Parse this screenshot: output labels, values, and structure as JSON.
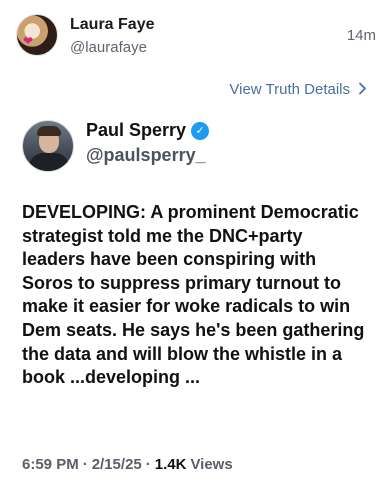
{
  "outer_post": {
    "display_name": "Laura Faye",
    "handle": "@laurafaye",
    "time_ago": "14m",
    "view_link_label": "View Truth Details",
    "view_link_icon": "chevron-right-icon"
  },
  "quoted_post": {
    "display_name": "Paul Sperry",
    "handle": "@paulsperry_",
    "verified": true,
    "verified_color": "#1d9bf0",
    "text": "DEVELOPING: A prominent Democratic strategist told me the DNC+party leaders have been conspiring with Soros to suppress primary turnout to make it easier for woke radicals to win Dem seats. He says he's been gathering the data and will blow the whistle in a book ...developing ...",
    "time": "6:59 PM",
    "date": "2/15/25",
    "views_count": "1.4K",
    "views_label": "Views",
    "separator": "·"
  },
  "colors": {
    "link": "#4a6fa1",
    "muted": "#5f6570",
    "text": "#111111"
  }
}
